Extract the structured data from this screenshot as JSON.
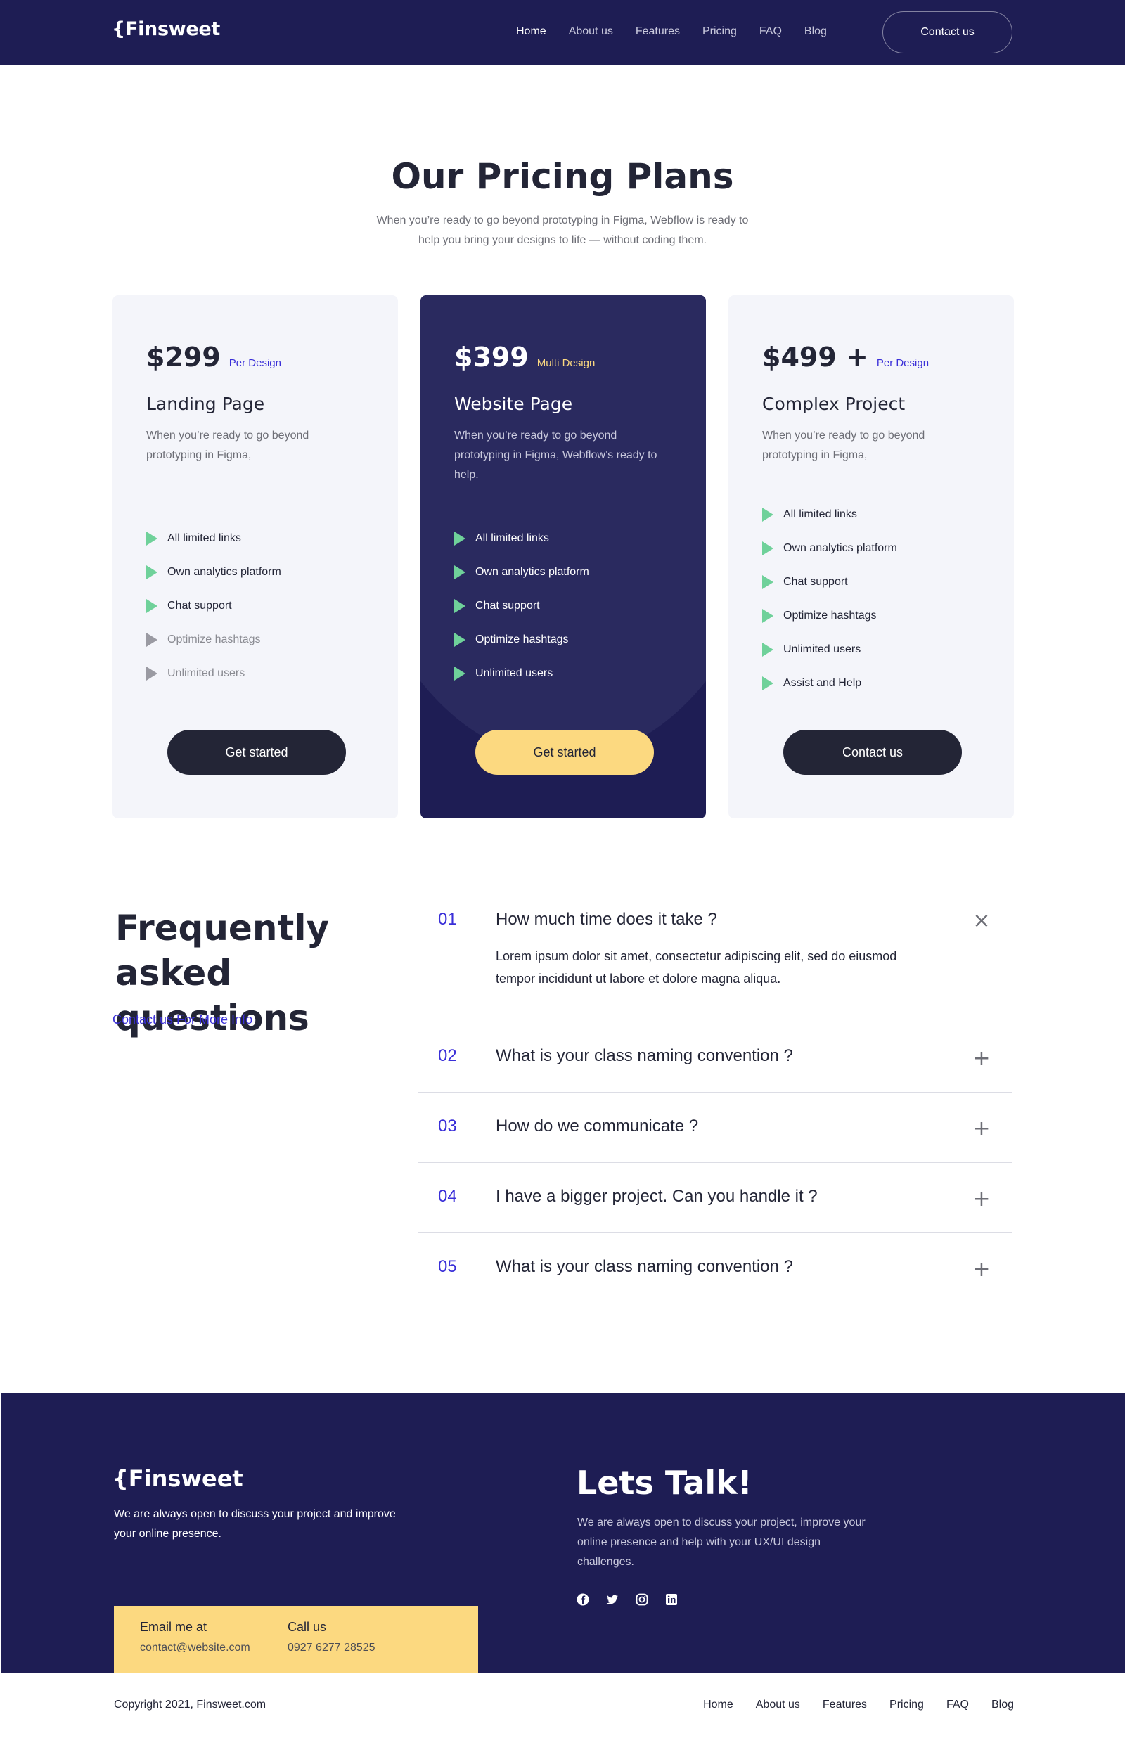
{
  "brand": {
    "logo": "{Finsweet"
  },
  "nav": {
    "items": [
      "Home",
      "About us",
      "Features",
      "Pricing",
      "FAQ",
      "Blog"
    ],
    "active": "Home",
    "cta": "Contact us"
  },
  "pricing": {
    "title": "Our Pricing Plans",
    "subtitle": "When you’re ready to go beyond prototyping in Figma, Webflow is ready to help you bring your designs to life — without coding them.",
    "plans": [
      {
        "price": "$299",
        "tag": "Per Design",
        "name": "Landing Page",
        "desc": "When you’re ready to go beyond prototyping in Figma,",
        "features": [
          {
            "label": "All limited links",
            "included": true
          },
          {
            "label": "Own analytics platform",
            "included": true
          },
          {
            "label": "Chat support",
            "included": true
          },
          {
            "label": "Optimize hashtags",
            "included": false
          },
          {
            "label": "Unlimited users",
            "included": false
          }
        ],
        "button": "Get started"
      },
      {
        "price": "$399",
        "tag": "Multi Design",
        "name": "Website Page",
        "desc": "When you’re ready to go beyond prototyping in Figma, Webflow’s ready to help.",
        "features": [
          {
            "label": "All limited links",
            "included": true
          },
          {
            "label": "Own analytics platform",
            "included": true
          },
          {
            "label": "Chat support",
            "included": true
          },
          {
            "label": "Optimize hashtags",
            "included": true
          },
          {
            "label": "Unlimited users",
            "included": true
          }
        ],
        "button": "Get started"
      },
      {
        "price": "$499 +",
        "tag": "Per Design",
        "name": "Complex Project",
        "desc": "When you’re ready to go beyond prototyping in Figma,",
        "features": [
          {
            "label": "All limited links",
            "included": true
          },
          {
            "label": "Own analytics platform",
            "included": true
          },
          {
            "label": "Chat support",
            "included": true
          },
          {
            "label": "Optimize hashtags",
            "included": true
          },
          {
            "label": "Unlimited users",
            "included": true
          },
          {
            "label": "Assist and Help",
            "included": true
          }
        ],
        "button": "Contact us"
      }
    ]
  },
  "faq": {
    "title": "Frequently asked questions",
    "link": "Contact us For More Info",
    "items": [
      {
        "num": "01",
        "question": "How much time does it take ?",
        "answer": "Lorem ipsum dolor sit amet, consectetur adipiscing elit, sed do eiusmod tempor incididunt ut labore et dolore magna aliqua.",
        "open": true
      },
      {
        "num": "02",
        "question": "What is your class naming convention ?",
        "open": false
      },
      {
        "num": "03",
        "question": "How do we communicate ?",
        "open": false
      },
      {
        "num": "04",
        "question": "I have a bigger project. Can you handle it ?",
        "open": false
      },
      {
        "num": "05",
        "question": "What is your class naming convention ?",
        "open": false
      }
    ]
  },
  "footer": {
    "logo": "{Finsweet",
    "desc": "We are always open to discuss your project and improve your online presence.",
    "email_label": "Email me at",
    "email": "contact@website.com",
    "phone_label": "Call us",
    "phone": "0927 6277 28525",
    "talk_title": "Lets Talk!",
    "talk_desc": "We are always open to discuss your project, improve your online presence and help with your UX/UI design challenges.",
    "socials": [
      "facebook-icon",
      "twitter-icon",
      "instagram-icon",
      "linkedin-icon"
    ],
    "copyright": "Copyright 2021, Finsweet.com",
    "nav": [
      "Home",
      "About us",
      "Features",
      "Pricing",
      "FAQ",
      "Blog"
    ]
  },
  "colors": {
    "navy": "#1e1d54",
    "dark": "#232536",
    "yellow": "#fcd980",
    "accent": "#3a2fd8",
    "check_green": "#6fd19a",
    "light_card": "#f4f5fa"
  }
}
